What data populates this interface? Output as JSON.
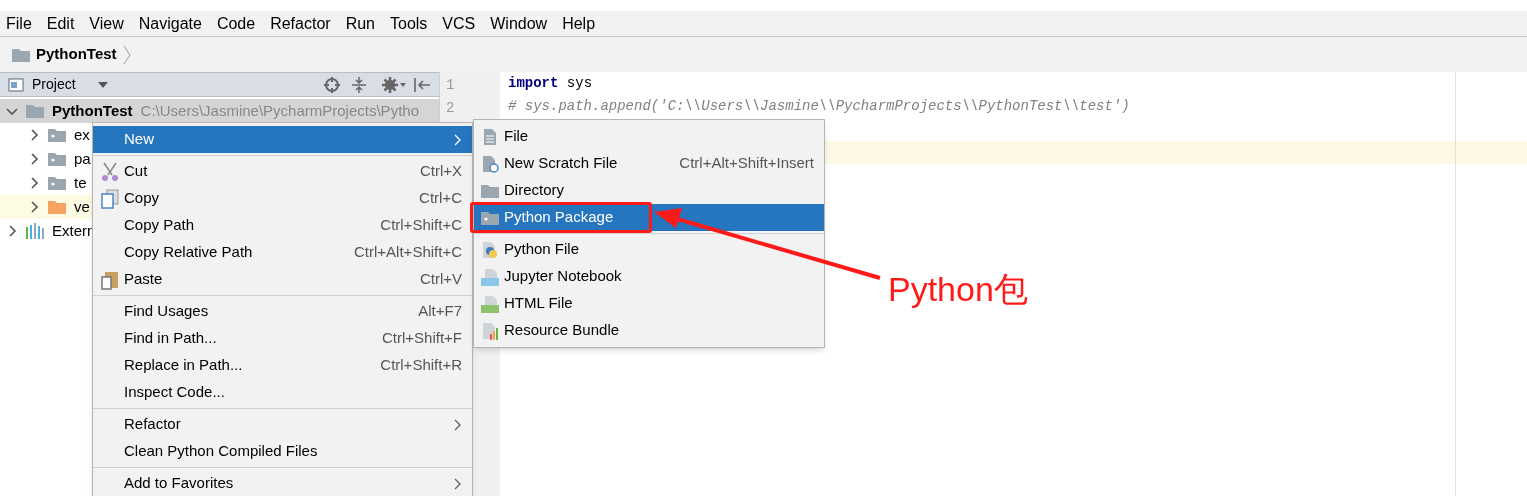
{
  "menu_bar": [
    "File",
    "Edit",
    "View",
    "Navigate",
    "Code",
    "Refactor",
    "Run",
    "Tools",
    "VCS",
    "Window",
    "Help"
  ],
  "breadcrumb": {
    "label": "PythonTest"
  },
  "project_panel": {
    "title": "Project",
    "tree": [
      {
        "label": "PythonTest",
        "path": "C:\\Users\\Jasmine\\PycharmProjects\\Pytho",
        "kind": "project",
        "expanded": true,
        "selected": true,
        "children": [
          {
            "label": "ex",
            "kind": "folder",
            "expanded": false,
            "selected": false,
            "highlighted": false
          },
          {
            "label": "pa",
            "kind": "folder",
            "expanded": false,
            "selected": false,
            "highlighted": false
          },
          {
            "label": "te",
            "kind": "folder",
            "expanded": false,
            "selected": false,
            "highlighted": false
          },
          {
            "label": "ve",
            "kind": "excluded",
            "expanded": false,
            "selected": false,
            "highlighted": true
          }
        ]
      },
      {
        "label": "Extern",
        "kind": "library",
        "expanded": false,
        "selected": false,
        "highlighted": false
      }
    ]
  },
  "editor": {
    "lines": [
      {
        "number": "1",
        "kind": "code",
        "keyword": "import",
        "text": " sys",
        "current": false
      },
      {
        "number": "2",
        "kind": "comment",
        "text": "# sys.path.append('C:\\\\Users\\\\Jasmine\\\\PycharmProjects\\\\PythonTest\\\\test')",
        "current": false
      },
      {
        "kind": "blank",
        "current": false
      },
      {
        "kind": "blank",
        "current": true
      }
    ]
  },
  "context_menu": [
    {
      "kind": "plain",
      "label": "New",
      "submenu": true,
      "selected": true
    },
    {
      "kind": "separator"
    },
    {
      "kind": "cut",
      "label": "Cut",
      "shortcut": "Ctrl+X",
      "submenu": false,
      "selected": false
    },
    {
      "kind": "copy",
      "label": "Copy",
      "shortcut": "Ctrl+C",
      "submenu": false,
      "selected": false
    },
    {
      "kind": "plain",
      "label": "Copy Path",
      "shortcut": "Ctrl+Shift+C",
      "submenu": false,
      "selected": false
    },
    {
      "kind": "plain",
      "label": "Copy Relative Path",
      "shortcut": "Ctrl+Alt+Shift+C",
      "submenu": false,
      "selected": false
    },
    {
      "kind": "paste",
      "label": "Paste",
      "shortcut": "Ctrl+V",
      "submenu": false,
      "selected": false
    },
    {
      "kind": "separator"
    },
    {
      "kind": "plain",
      "label": "Find Usages",
      "shortcut": "Alt+F7",
      "submenu": false,
      "selected": false
    },
    {
      "kind": "plain",
      "label": "Find in Path...",
      "shortcut": "Ctrl+Shift+F",
      "submenu": false,
      "selected": false
    },
    {
      "kind": "plain",
      "label": "Replace in Path...",
      "shortcut": "Ctrl+Shift+R",
      "submenu": false,
      "selected": false
    },
    {
      "kind": "plain",
      "label": "Inspect Code...",
      "submenu": false,
      "selected": false
    },
    {
      "kind": "separator"
    },
    {
      "kind": "plain",
      "label": "Refactor",
      "submenu": true,
      "selected": false
    },
    {
      "kind": "plain",
      "label": "Clean Python Compiled Files",
      "submenu": false,
      "selected": false
    },
    {
      "kind": "separator"
    },
    {
      "kind": "plain",
      "label": "Add to Favorites",
      "submenu": true,
      "selected": false
    }
  ],
  "submenu": [
    {
      "kind": "file",
      "label": "File",
      "selected": false,
      "outlined": false
    },
    {
      "kind": "scratch",
      "label": "New Scratch File",
      "shortcut": "Ctrl+Alt+Shift+Insert",
      "selected": false,
      "outlined": false
    },
    {
      "kind": "directory",
      "label": "Directory",
      "selected": false,
      "outlined": false
    },
    {
      "kind": "package",
      "label": "Python Package",
      "selected": true,
      "outlined": true
    },
    {
      "kind": "separator"
    },
    {
      "kind": "python",
      "label": "Python File",
      "selected": false,
      "outlined": false
    },
    {
      "kind": "jupyter",
      "label": "Jupyter Notebook",
      "selected": false,
      "outlined": false
    },
    {
      "kind": "html",
      "label": "HTML File",
      "selected": false,
      "outlined": false
    },
    {
      "kind": "resource",
      "label": "Resource Bundle",
      "selected": false,
      "outlined": false
    }
  ],
  "annotation": {
    "label": "Python包"
  }
}
